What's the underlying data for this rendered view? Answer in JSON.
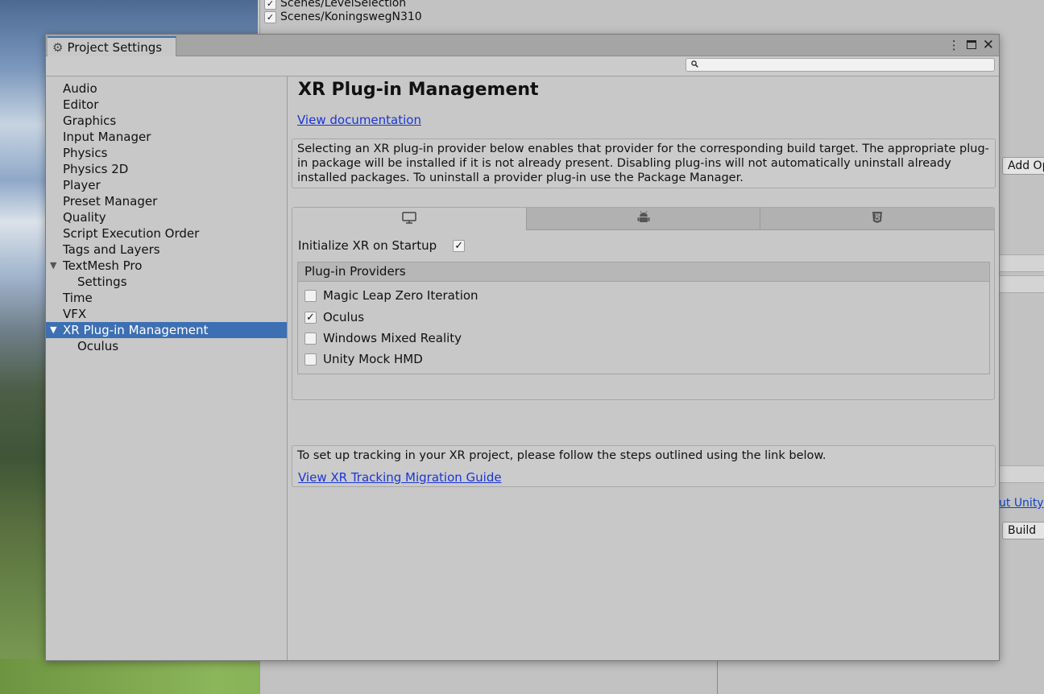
{
  "background": {
    "scene_list": [
      {
        "label": "Scenes/LevelSelection",
        "checked": true
      },
      {
        "label": "Scenes/KoningswegN310",
        "checked": true
      }
    ],
    "add_button_label": "Add Op",
    "unity_link_text": "ut Unity",
    "build_button_label": "Build"
  },
  "window": {
    "tab_title": "Project Settings",
    "tab_icon": "gear-icon",
    "controls": [
      "more-options-icon",
      "maximize-icon",
      "close-icon"
    ],
    "search": {
      "placeholder": "",
      "value": ""
    }
  },
  "sidebar": {
    "items": [
      {
        "label": "Audio"
      },
      {
        "label": "Editor"
      },
      {
        "label": "Graphics"
      },
      {
        "label": "Input Manager"
      },
      {
        "label": "Physics"
      },
      {
        "label": "Physics 2D"
      },
      {
        "label": "Player"
      },
      {
        "label": "Preset Manager"
      },
      {
        "label": "Quality"
      },
      {
        "label": "Script Execution Order"
      },
      {
        "label": "Tags and Layers"
      },
      {
        "label": "TextMesh Pro",
        "expanded": true
      },
      {
        "label": "Settings",
        "child": true
      },
      {
        "label": "Time"
      },
      {
        "label": "VFX"
      },
      {
        "label": "XR Plug-in Management",
        "expanded": true,
        "selected": true
      },
      {
        "label": "Oculus",
        "child": true
      }
    ]
  },
  "main": {
    "title": "XR Plug-in Management",
    "doc_link": "View documentation",
    "info_text": "Selecting an XR plug-in provider below enables that provider for the corresponding build target. The appropriate plug-in package will be installed if it is not already present. Disabling plug-ins will not automatically uninstall already installed packages. To uninstall a provider plug-in use the Package Manager.",
    "platform_tabs": [
      {
        "icon": "desktop-icon",
        "active": true
      },
      {
        "icon": "android-icon",
        "active": false
      },
      {
        "icon": "html5-icon",
        "active": false
      }
    ],
    "init_on_startup": {
      "label": "Initialize XR on Startup",
      "checked": true
    },
    "providers": {
      "header": "Plug-in Providers",
      "items": [
        {
          "label": "Magic Leap Zero Iteration",
          "checked": false
        },
        {
          "label": "Oculus",
          "checked": true
        },
        {
          "label": "Windows Mixed Reality",
          "checked": false
        },
        {
          "label": "Unity Mock HMD",
          "checked": false
        }
      ]
    },
    "tracking": {
      "text": "To set up tracking in your XR project, please follow the steps outlined using the link below.",
      "link": "View XR Tracking Migration Guide"
    }
  },
  "colors": {
    "selection": "#3d6fb3",
    "link": "#1a35d8",
    "window_bg": "#c8c8c8",
    "titlebar_bg": "#a5a5a5"
  }
}
